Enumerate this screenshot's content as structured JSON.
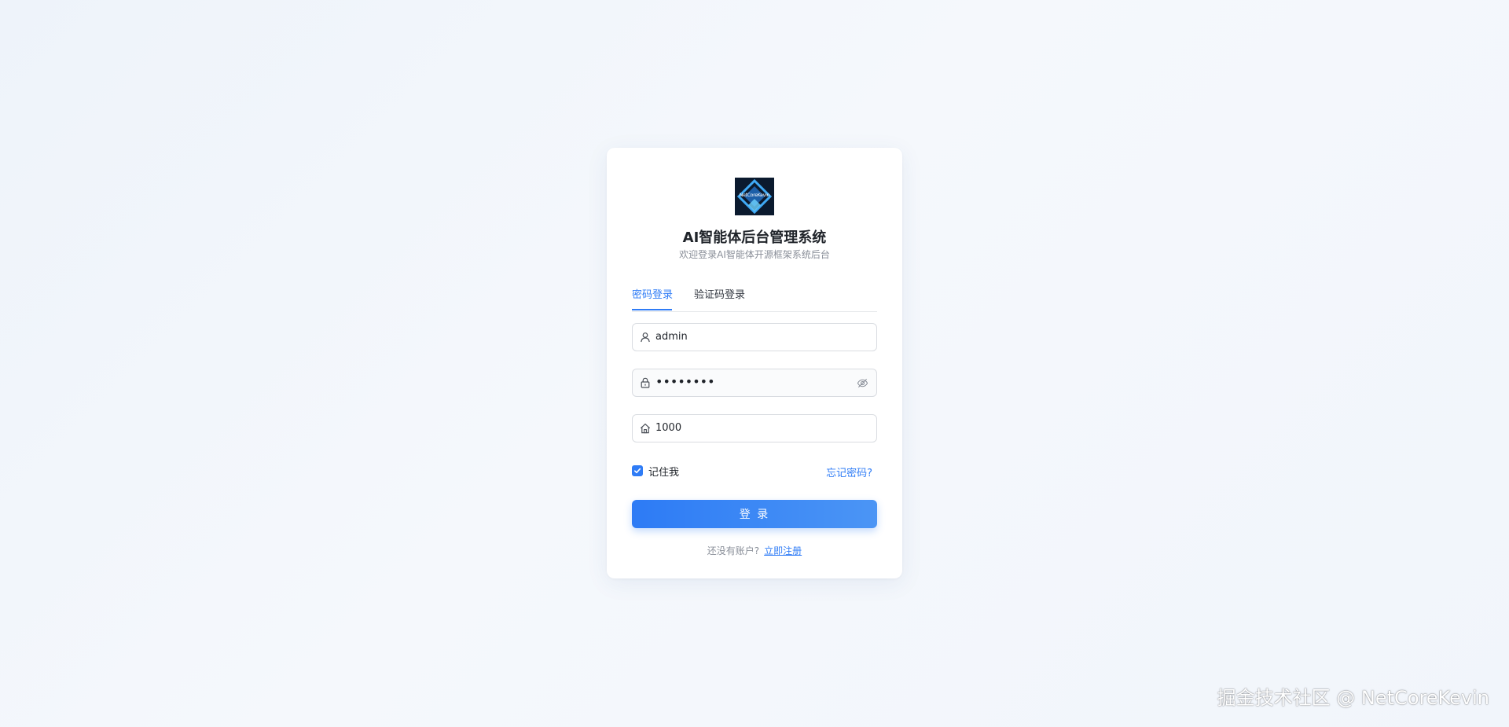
{
  "app": {
    "logo_text": "NetCoreKevin",
    "title": "AI智能体后台管理系统",
    "subtitle": "欢迎登录AI智能体开源框架系统后台"
  },
  "tabs": [
    {
      "label": "密码登录",
      "active": true
    },
    {
      "label": "验证码登录",
      "active": false
    }
  ],
  "form": {
    "username": {
      "value": "admin",
      "icon": "user-icon"
    },
    "password": {
      "value": "••••••••",
      "icon": "lock-icon",
      "toggle_icon": "eye-off-icon"
    },
    "tenant": {
      "value": "1000",
      "icon": "home-icon"
    },
    "remember_label": "记住我",
    "remember_checked": true,
    "forgot_label": "忘记密码?",
    "submit_label": "登 录"
  },
  "register": {
    "prompt": "还没有账户?",
    "link_label": "立即注册"
  },
  "watermark": "掘金技术社区 @ NetCoreKevin",
  "colors": {
    "accent": "#2f7cf6",
    "background": "#f1f5fb",
    "card": "#ffffff"
  }
}
